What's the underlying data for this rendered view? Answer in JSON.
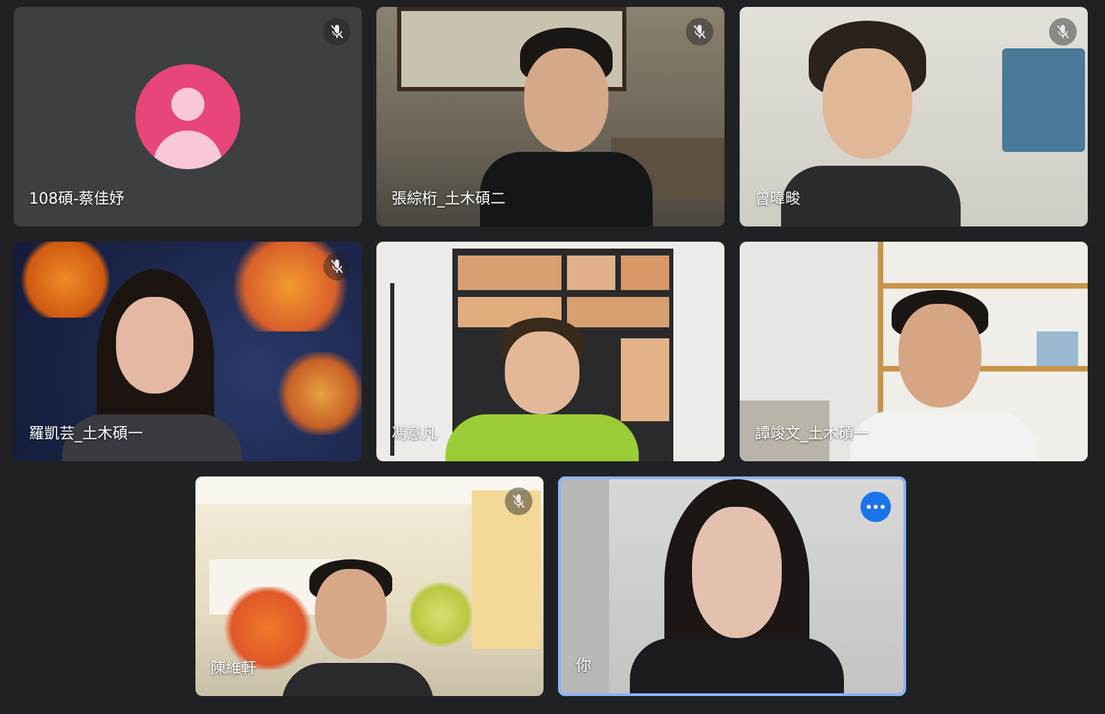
{
  "app": {
    "title": ""
  },
  "participants": [
    {
      "name": "108碩-蔡佳妤",
      "muted": true,
      "camera": false,
      "avatar_color": "#e8457a"
    },
    {
      "name": "張綜桁_土木碩二",
      "muted": true,
      "camera": true
    },
    {
      "name": "曾暐畯",
      "muted": true,
      "camera": true
    },
    {
      "name": "羅凱芸_土木碩一",
      "muted": true,
      "camera": true
    },
    {
      "name": "馮意凡",
      "muted": false,
      "camera": true
    },
    {
      "name": "譚竣文_土木碩一",
      "muted": false,
      "camera": true
    },
    {
      "name": "陳維軒",
      "muted": true,
      "camera": true
    },
    {
      "name": "你",
      "muted": false,
      "camera": true,
      "self": true,
      "speaking": true
    }
  ],
  "icons": {
    "mute": "mic-off-icon",
    "more": "more-options-icon",
    "avatar": "person-icon"
  },
  "colors": {
    "background": "#202124",
    "tile": "#3c4043",
    "active_border": "#8ab4f8",
    "more_button": "#1a73e8"
  }
}
